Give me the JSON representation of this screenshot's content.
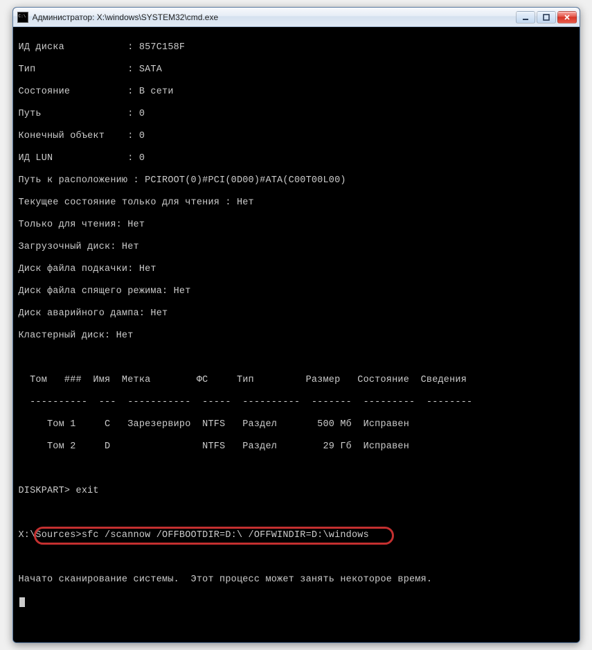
{
  "window": {
    "title": "Администратор: X:\\windows\\SYSTEM32\\cmd.exe"
  },
  "lines": {
    "l0": "ИД диска           : 857C158F",
    "l1": "Тип                : SATA",
    "l2": "Состояние          : В сети",
    "l3": "Путь               : 0",
    "l4": "Конечный объект    : 0",
    "l5": "ИД LUN             : 0",
    "l6": "Путь к расположению : PCIROOT(0)#PCI(0D00)#ATA(C00T00L00)",
    "l7": "Текущее состояние только для чтения : Нет",
    "l8": "Только для чтения: Нет",
    "l9": "Загрузочный диск: Нет",
    "l10": "Диск файла подкачки: Нет",
    "l11": "Диск файла спящего режима: Нет",
    "l12": "Диск аварийного дампа: Нет",
    "l13": "Кластерный диск: Нет",
    "blank": " ",
    "th": "  Том   ###  Имя  Метка        ФС     Тип         Размер   Состояние  Сведения",
    "sep": "  ----------  ---  -----------  -----  ----------  -------  ---------  --------",
    "r1": "     Том 1     C   Зарезервиро  NTFS   Раздел       500 Мб  Исправен",
    "r2": "     Том 2     D                NTFS   Раздел        29 Гб  Исправен",
    "exit": "DISKPART> exit",
    "cmd": "X:\\Sources>sfc /scannow /OFFBOOTDIR=D:\\ /OFFWINDIR=D:\\windows",
    "scan": "Начато сканирование системы.  Этот процесс может занять некоторое время."
  }
}
